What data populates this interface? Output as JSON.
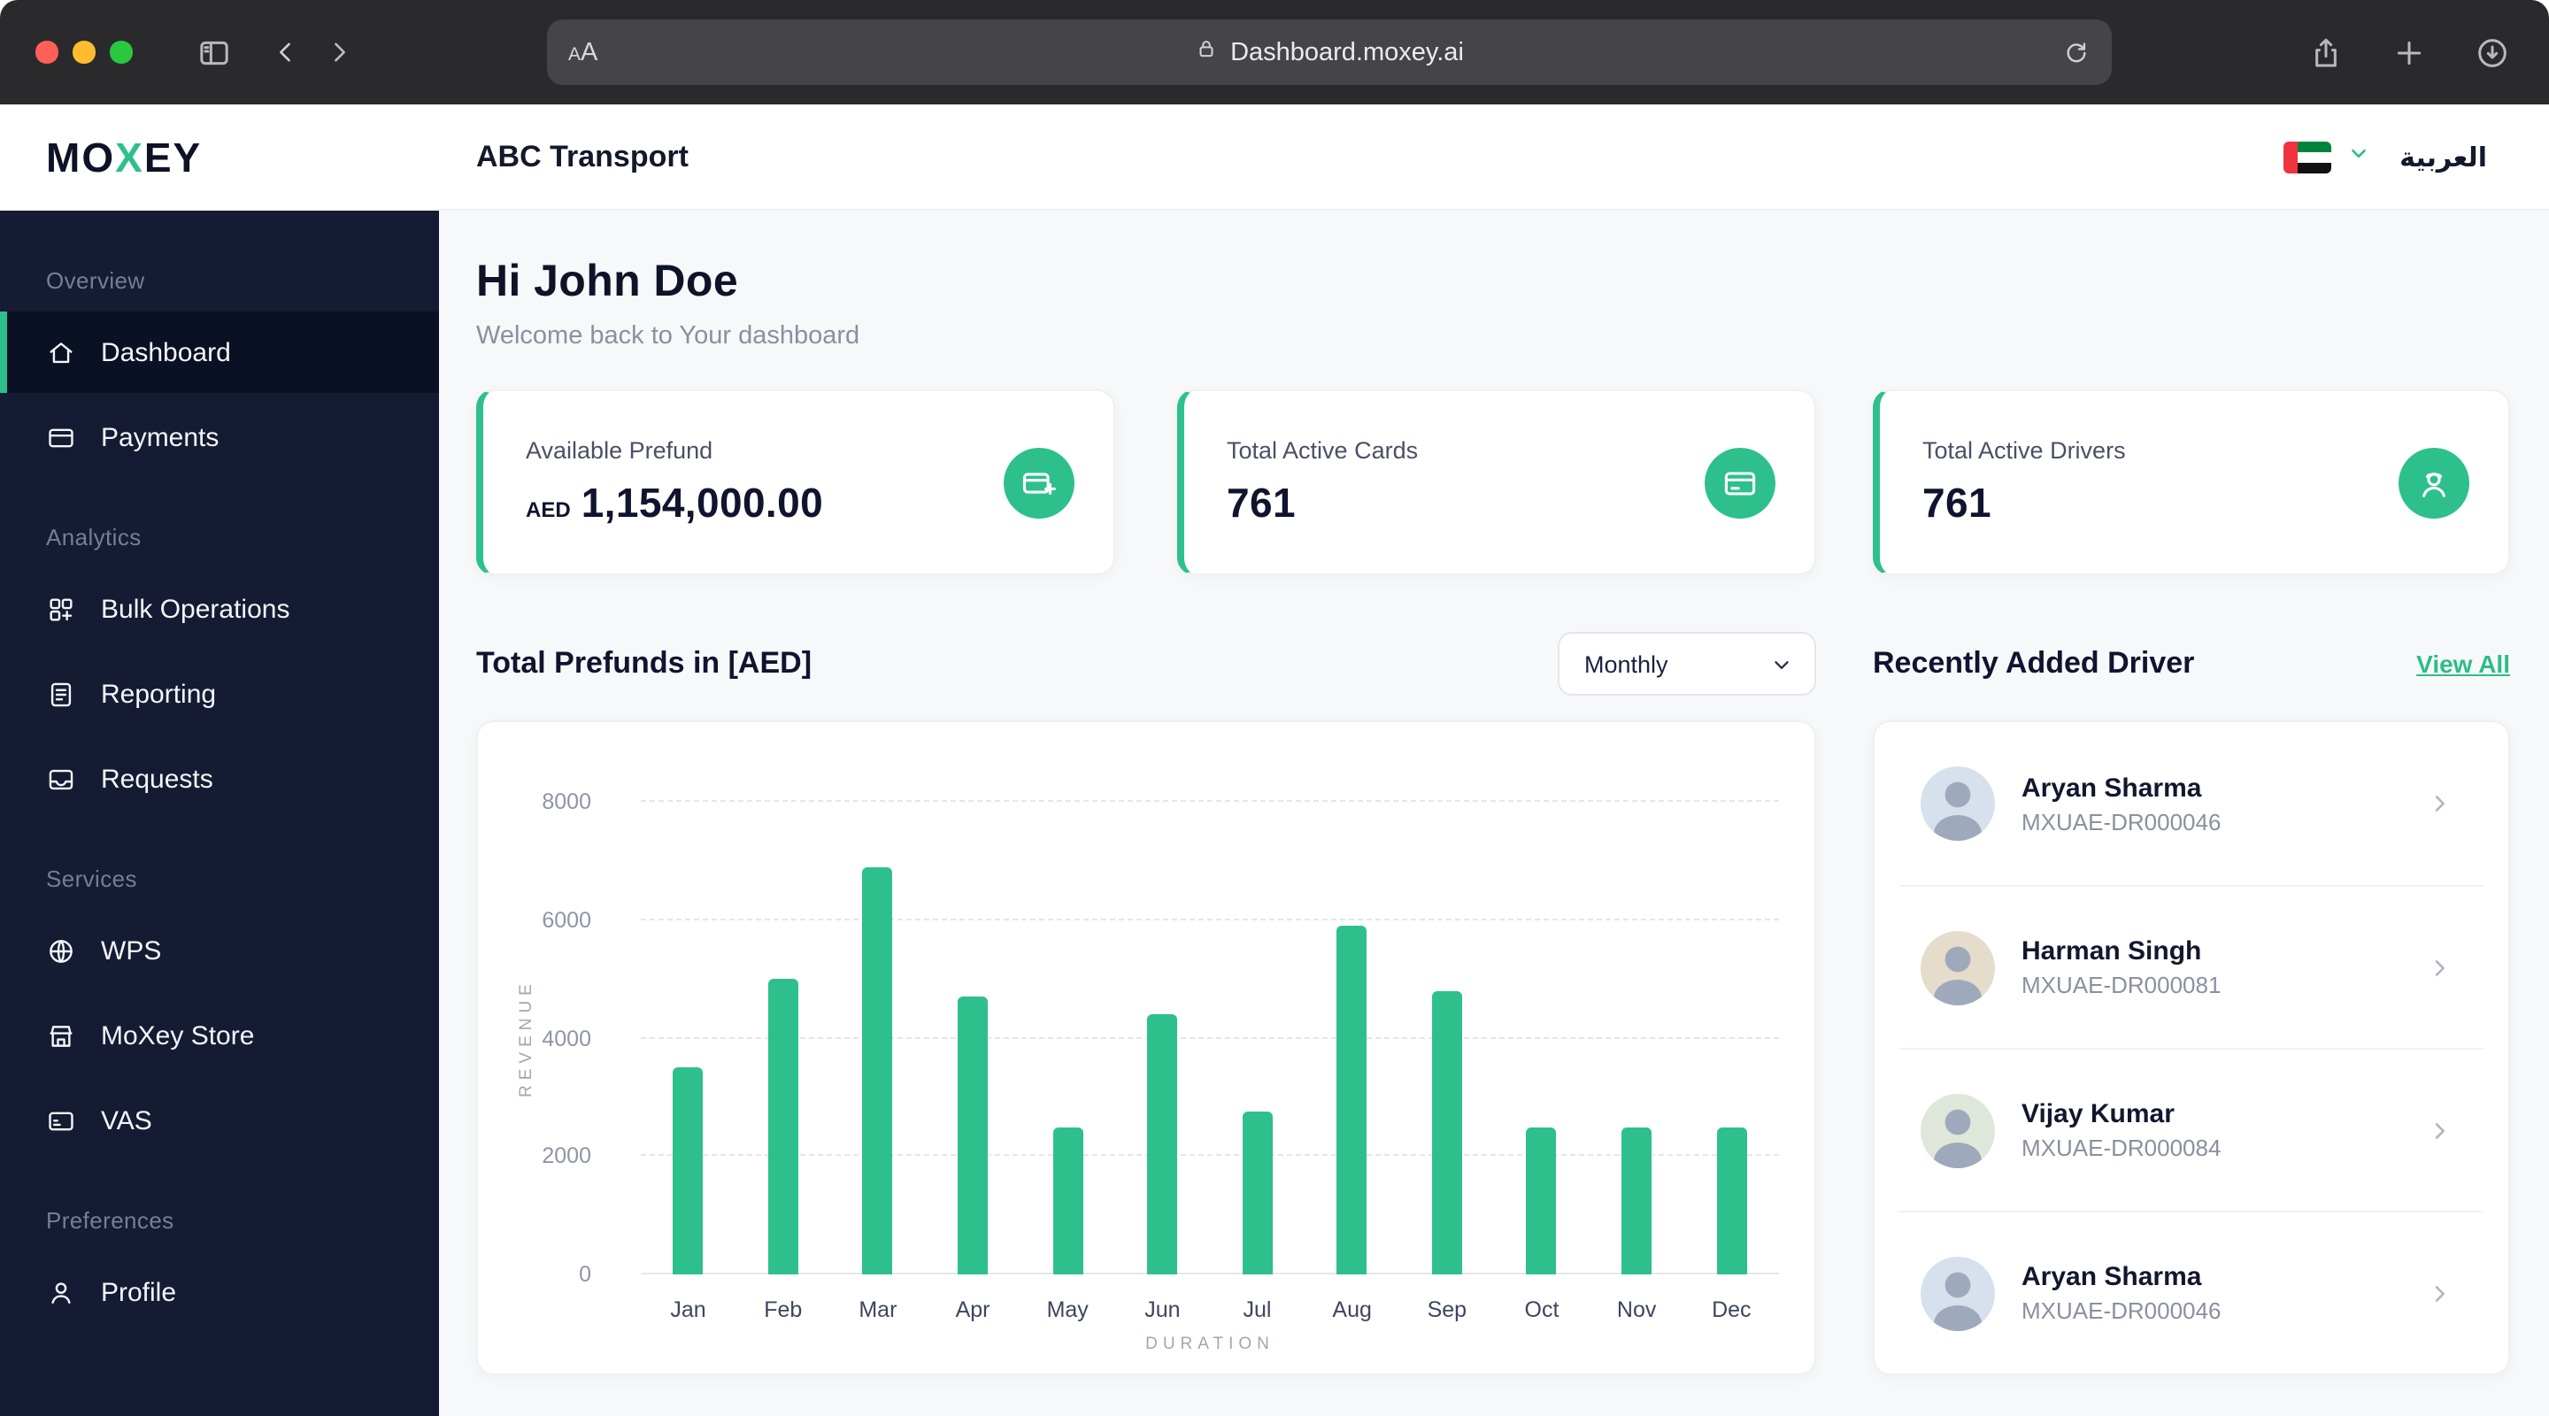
{
  "colors": {
    "accent": "#2EC08C",
    "sidebar_bg": "#151B33",
    "active_item_bg": "#0A1124",
    "page_bg": "#F7F8FA",
    "link_green": "#2EBD86"
  },
  "browser": {
    "text_size_small": "A",
    "text_size_large": "A",
    "url": "Dashboard.moxey.ai"
  },
  "logo": {
    "pre": "MO",
    "x": "X",
    "post": "EY"
  },
  "sidebar": {
    "sections": [
      {
        "label": "Overview"
      },
      {
        "label": "Analytics"
      },
      {
        "label": "Services"
      },
      {
        "label": "Preferences"
      }
    ],
    "items": {
      "dashboard": "Dashboard",
      "payments": "Payments",
      "bulk_operations": "Bulk Operations",
      "reporting": "Reporting",
      "requests": "Requests",
      "wps": "WPS",
      "moxey_store": "MoXey Store",
      "vas": "VAS",
      "profile": "Profile"
    }
  },
  "header": {
    "company": "ABC Transport",
    "language": "العربية"
  },
  "main": {
    "greeting": "Hi John Doe",
    "subtitle": "Welcome back to Your dashboard",
    "stats": [
      {
        "label": "Available Prefund",
        "currency": "AED",
        "value": "1,154,000.00",
        "icon": "card-plus-icon"
      },
      {
        "label": "Total Active Cards",
        "value": "761",
        "icon": "card-icon"
      },
      {
        "label": "Total Active Drivers",
        "value": "761",
        "icon": "driver-icon"
      }
    ],
    "chart_title": "Total Prefunds in [AED]",
    "chart_filter": "Monthly"
  },
  "chart_data": {
    "type": "bar",
    "title": "Total Prefunds in [AED]",
    "categories": [
      "Jan",
      "Feb",
      "Mar",
      "Apr",
      "May",
      "Jun",
      "Jul",
      "Aug",
      "Sep",
      "Oct",
      "Nov",
      "Dec"
    ],
    "values": [
      3500,
      5000,
      6900,
      4700,
      2500,
      4400,
      2750,
      5900,
      4800,
      2500,
      2500,
      2500
    ],
    "xlabel": "DURATION",
    "ylabel": "REVENUE",
    "ylim": [
      0,
      8000
    ],
    "yticks": [
      0,
      2000,
      4000,
      6000,
      8000
    ],
    "bar_color": "#2EC08C",
    "grid": "horizontal-dashed",
    "legend": "none"
  },
  "drivers_panel": {
    "title": "Recently Added Driver",
    "view_all": "View All",
    "drivers": [
      {
        "name": "Aryan Sharma",
        "id": "MXUAE-DR000046"
      },
      {
        "name": "Harman Singh",
        "id": "MXUAE-DR000081"
      },
      {
        "name": "Vijay Kumar",
        "id": "MXUAE-DR000084"
      },
      {
        "name": "Aryan Sharma",
        "id": "MXUAE-DR000046"
      }
    ]
  }
}
